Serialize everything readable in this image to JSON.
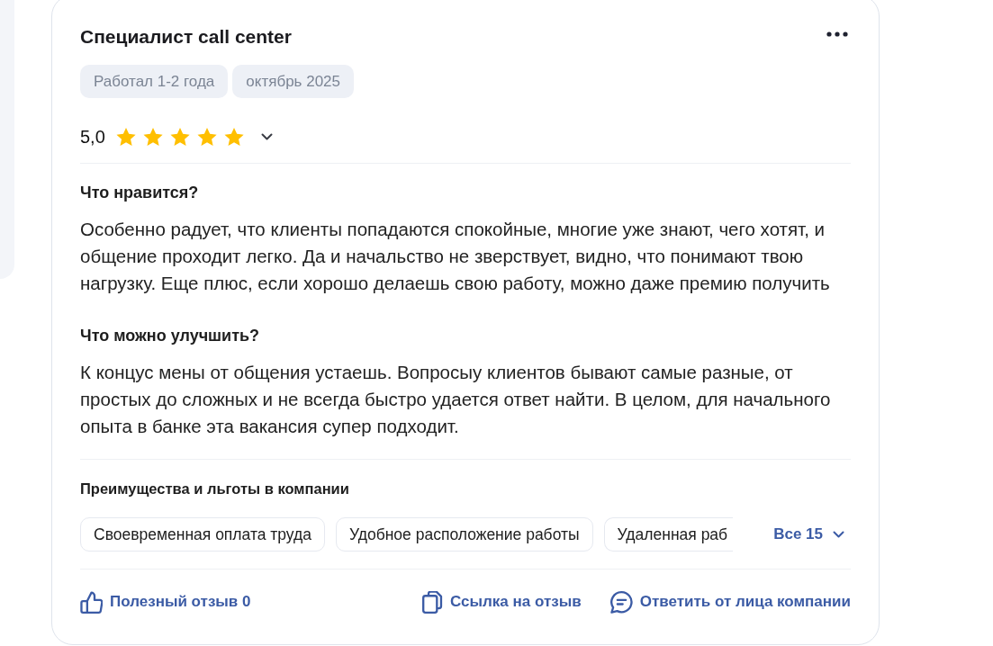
{
  "review": {
    "title": "Специалист call center",
    "tags": [
      "Работал 1-2 года",
      "октябрь 2025"
    ],
    "rating": {
      "value": "5,0",
      "stars": 5
    },
    "sections": [
      {
        "heading": "Что нравится?",
        "text": "Особенно радует, что клиенты попадаются спокойные, многие уже знают, чего хотят, и общение проходит легко. Да и начальство не зверствует, видно, что понимают твою нагрузку. Еще плюс, если хорошо делаешь свою работу, можно даже премию получить"
      },
      {
        "heading": "Что можно улучшить?",
        "text": "К концус мены от общения устаешь. Вопросыу клиентов бывают самые разные, от простых до сложных и не всегда быстро удается ответ найти. В целом, для начального опыта в банке эта вакансия супер подходит."
      }
    ],
    "benefits": {
      "heading": "Преимущества и льготы в компании",
      "items": [
        {
          "label": "Своевременная оплата труда",
          "cut": false
        },
        {
          "label": "Удобное расположение работы",
          "cut": false
        },
        {
          "label": "Удаленная раб",
          "cut": true
        }
      ],
      "more": "Все 15"
    },
    "actions": [
      {
        "kind": "helpful",
        "label": "Полезный отзыв 0"
      },
      {
        "kind": "link",
        "label": "Ссылка на отзыв"
      },
      {
        "kind": "reply",
        "label": "Ответить от лица компании"
      }
    ]
  }
}
